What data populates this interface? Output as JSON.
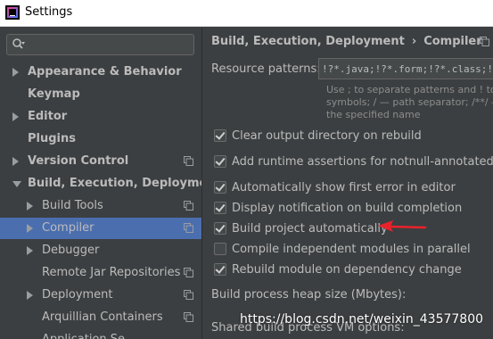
{
  "window": {
    "title": "Settings"
  },
  "search": {
    "placeholder": "",
    "value": ""
  },
  "sidebar": {
    "items": [
      {
        "label": "Appearance & Behavior",
        "level": 0,
        "arrow": "right",
        "bold": true,
        "copy_icon": false
      },
      {
        "label": "Keymap",
        "level": 0,
        "arrow": "none",
        "bold": true,
        "copy_icon": false
      },
      {
        "label": "Editor",
        "level": 0,
        "arrow": "right",
        "bold": true,
        "copy_icon": false
      },
      {
        "label": "Plugins",
        "level": 0,
        "arrow": "none",
        "bold": true,
        "copy_icon": false
      },
      {
        "label": "Version Control",
        "level": 0,
        "arrow": "right",
        "bold": true,
        "copy_icon": true
      },
      {
        "label": "Build, Execution, Deployment",
        "level": 0,
        "arrow": "down",
        "bold": true,
        "copy_icon": false
      },
      {
        "label": "Build Tools",
        "level": 1,
        "arrow": "right",
        "bold": false,
        "copy_icon": true
      },
      {
        "label": "Compiler",
        "level": 1,
        "arrow": "right",
        "bold": false,
        "copy_icon": true,
        "selected": true
      },
      {
        "label": "Debugger",
        "level": 1,
        "arrow": "right",
        "bold": false,
        "copy_icon": false
      },
      {
        "label": "Remote Jar Repositories",
        "level": 1,
        "arrow": "none",
        "bold": false,
        "copy_icon": true
      },
      {
        "label": "Deployment",
        "level": 1,
        "arrow": "right",
        "bold": false,
        "copy_icon": true
      },
      {
        "label": "Arquillian Containers",
        "level": 1,
        "arrow": "none",
        "bold": false,
        "copy_icon": true
      },
      {
        "label": "Application Se...",
        "level": 1,
        "arrow": "none",
        "bold": false,
        "copy_icon": false
      }
    ]
  },
  "breadcrumb": {
    "parent": "Build, Execution, Deployment",
    "separator": "›",
    "current": "Compiler"
  },
  "resource_patterns": {
    "label": "Resource patterns:",
    "value": "!?*.java;!?*.form;!?*.class;!?*.groovy",
    "hint_lines": [
      "Use ; to separate patterns and ! to negate",
      "symbols; / — path separator; /**/ — any",
      "the specified name"
    ]
  },
  "options": [
    {
      "label": "Clear output directory on rebuild",
      "checked": true
    },
    {
      "label": "Add runtime assertions for notnull-annotated methods",
      "checked": true
    },
    {
      "label": "Automatically show first error in editor",
      "checked": true
    },
    {
      "label": "Display notification on build completion",
      "checked": true
    },
    {
      "label": "Build project automatically",
      "checked": true
    },
    {
      "label": "Compile independent modules in parallel",
      "checked": false
    },
    {
      "label": "Rebuild module on dependency change",
      "checked": true
    }
  ],
  "heap_size": {
    "label": "Build process heap size (Mbytes):"
  },
  "vm_options": {
    "label": "Shared build process VM options:"
  },
  "watermark": "https://blog.csdn.net/weixin_43577800",
  "colors": {
    "background": "#3c3f41",
    "selection": "#4b6eaf",
    "text": "#bbbbbb",
    "hint": "#8c8c8c",
    "annotation_arrow": "#e8222b"
  }
}
